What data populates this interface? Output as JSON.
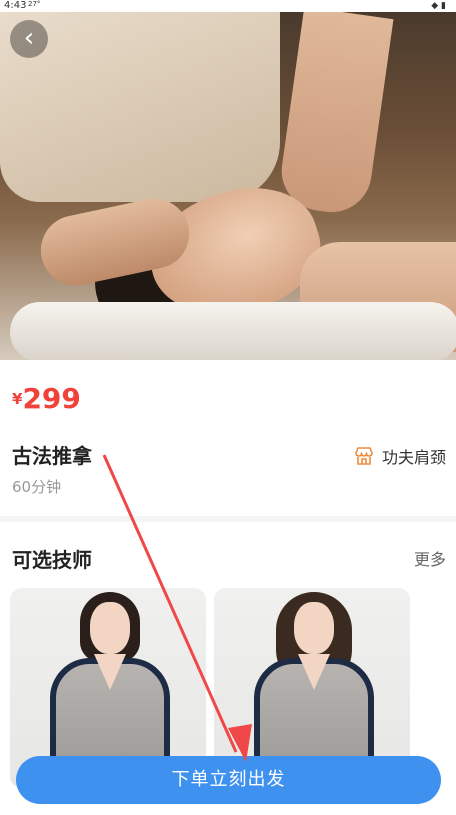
{
  "status_bar": {
    "time": "4:43",
    "temp": "27°"
  },
  "service": {
    "currency": "¥",
    "price": "299",
    "name": "古法推拿",
    "duration": "60分钟",
    "shop_name": "功夫肩颈"
  },
  "technicians": {
    "title": "可选技师",
    "more_label": "更多"
  },
  "cta": {
    "label": "下单立刻出发"
  },
  "colors": {
    "price": "#f0413a",
    "accent": "#3e91ef",
    "shop_icon": "#f08a3c",
    "annotation_arrow": "#f04848"
  }
}
